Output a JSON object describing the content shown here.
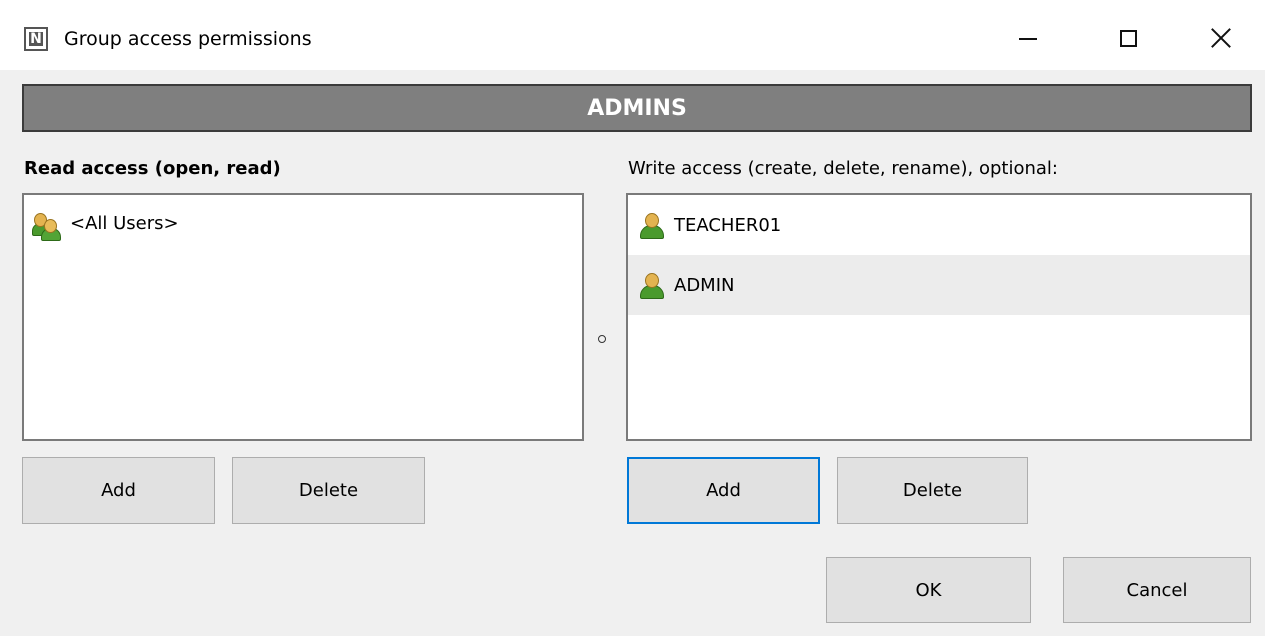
{
  "window": {
    "title": "Group access permissions",
    "app_icon_letter": "N",
    "controls": [
      "minimize-icon",
      "maximize-icon",
      "close-icon"
    ]
  },
  "group_name": "ADMINS",
  "read_access": {
    "label": "Read access (open, read)",
    "items": [
      {
        "label": "<All Users>",
        "icon": "users-icon",
        "selected": false
      }
    ],
    "add_label": "Add",
    "delete_label": "Delete"
  },
  "write_access": {
    "label": "Write access (create, delete, rename), optional:",
    "items": [
      {
        "label": "TEACHER01",
        "icon": "user-icon",
        "selected": false
      },
      {
        "label": "ADMIN",
        "icon": "user-icon",
        "selected": true
      }
    ],
    "add_label": "Add",
    "delete_label": "Delete"
  },
  "footer": {
    "ok_label": "OK",
    "cancel_label": "Cancel"
  },
  "colors": {
    "banner_bg": "#7f7f7f",
    "focus_border": "#0078d7",
    "selected_row": "#ececec"
  }
}
